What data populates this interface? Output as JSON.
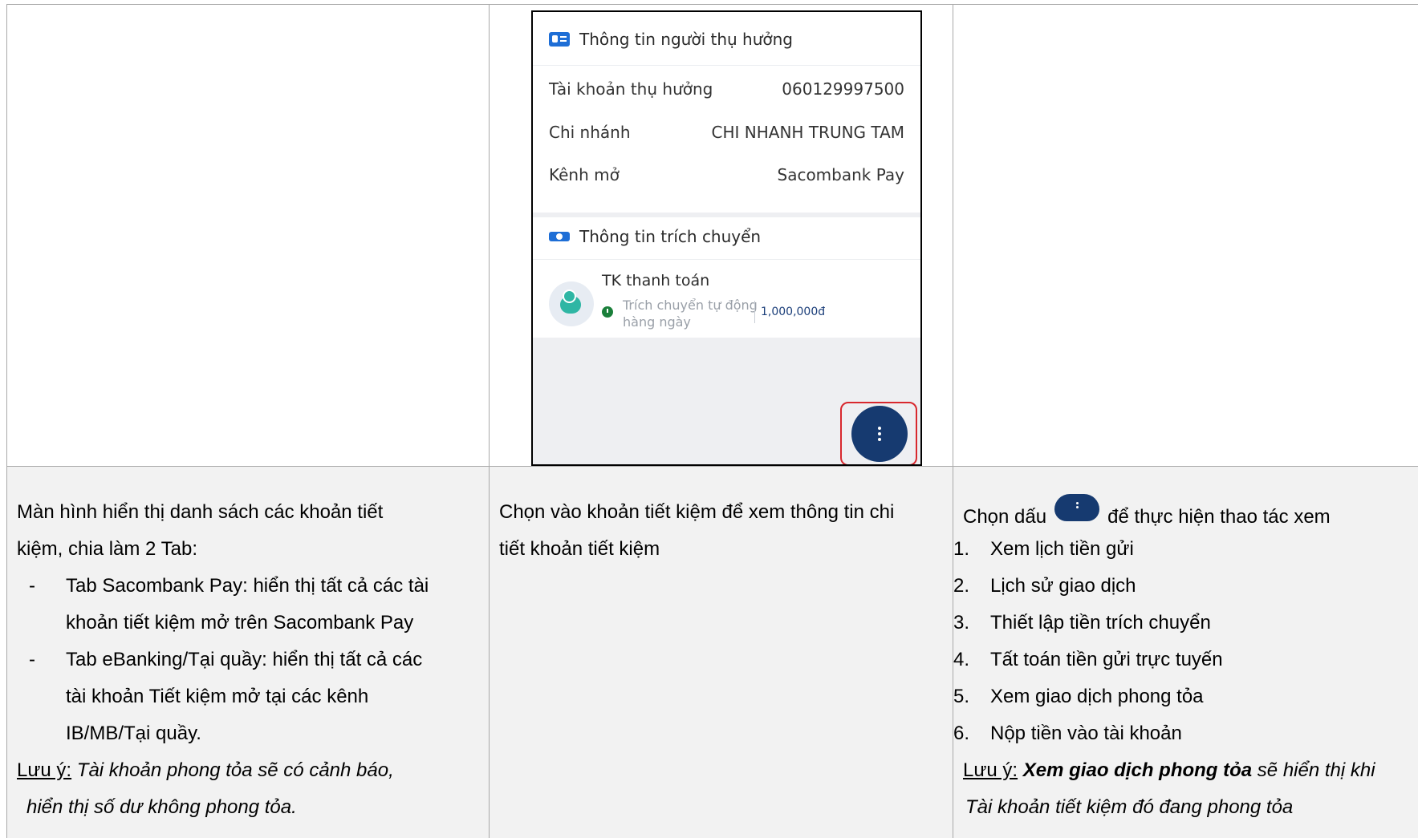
{
  "phone": {
    "beneficiary_title": "Thông tin người thụ hưởng",
    "rows": [
      {
        "label": "Tài khoản thụ hưởng",
        "value": "060129997500"
      },
      {
        "label": "Chi nhánh",
        "value": "CHI NHANH TRUNG TAM"
      },
      {
        "label": "Kênh mở",
        "value": "Sacombank Pay"
      }
    ],
    "transfer_title": "Thông tin trích chuyển",
    "account_name": "TK thanh toán",
    "schedule_line1": "Trích chuyển tự động",
    "schedule_line2": "hàng ngày",
    "amount": "1,000,000đ"
  },
  "col1": {
    "intro_line1": "Màn hình hiển thị danh sách các khoản tiết",
    "intro_line2": "kiệm, chia làm 2 Tab:",
    "bullet_marker": "-",
    "bullet1_line1": "Tab Sacombank Pay: hiển thị tất cả các tài",
    "bullet1_line2": "khoản tiết kiệm mở trên Sacombank Pay",
    "bullet2_line1": "Tab eBanking/Tại quầy: hiển thị tất cả các",
    "bullet2_line2": "tài khoản Tiết kiệm mở tại các kênh",
    "bullet2_line3": "IB/MB/Tại quầy.",
    "note_label": "Lưu ý:",
    "note_line1": "Tài khoản phong tỏa sẽ có cảnh báo,",
    "note_line2": "hiển thị số dư không phong tỏa."
  },
  "col2": {
    "line1": "Chọn vào khoản tiết kiệm để xem thông tin chi",
    "line2": "tiết khoản tiết kiệm"
  },
  "col3": {
    "intro_pre": "Chọn dấu",
    "intro_post": "để thực hiện thao tác xem",
    "items": [
      {
        "num": "1.",
        "text": "Xem lịch tiền gửi"
      },
      {
        "num": "2.",
        "text": "Lịch sử giao dịch"
      },
      {
        "num": "3.",
        "text": "Thiết lập tiền trích chuyển"
      },
      {
        "num": "4.",
        "text": "Tất toán tiền gửi trực tuyến"
      },
      {
        "num": "5.",
        "text": "Xem giao dịch phong tỏa"
      },
      {
        "num": "6.",
        "text": "Nộp tiền vào tài khoản"
      }
    ],
    "note_label": "Lưu ý:",
    "note_bold": "Xem giao dịch phong tỏa",
    "note_rest": "sẽ hiển thị khi",
    "note_line2": "Tài khoản tiết kiệm đó đang phong tỏa"
  },
  "colors": {
    "fab": "#163a70",
    "highlight": "#d8282e",
    "cell_bg": "#f2f2f2",
    "accent": "#1e6ed6"
  }
}
